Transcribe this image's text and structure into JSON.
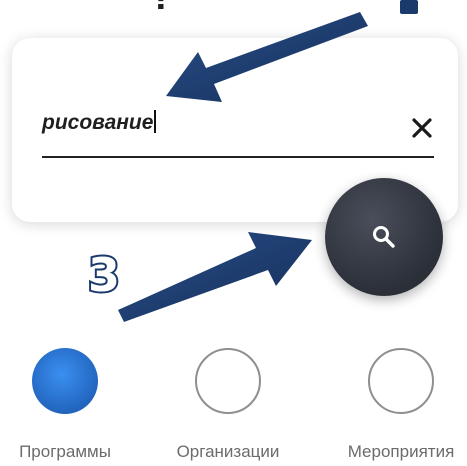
{
  "search": {
    "value": "рисование",
    "clear_icon": "close-icon",
    "submit_icon": "search-icon"
  },
  "annotations": {
    "step_number": "3",
    "top_fragment": "?",
    "arrow_color": "#1a3a6b"
  },
  "categories": [
    {
      "label": "Программы",
      "selected": true
    },
    {
      "label": "Организации",
      "selected": false
    },
    {
      "label": "Мероприятия",
      "selected": false
    }
  ],
  "colors": {
    "accent": "#2f7ee0",
    "fab": "#2f333c"
  }
}
